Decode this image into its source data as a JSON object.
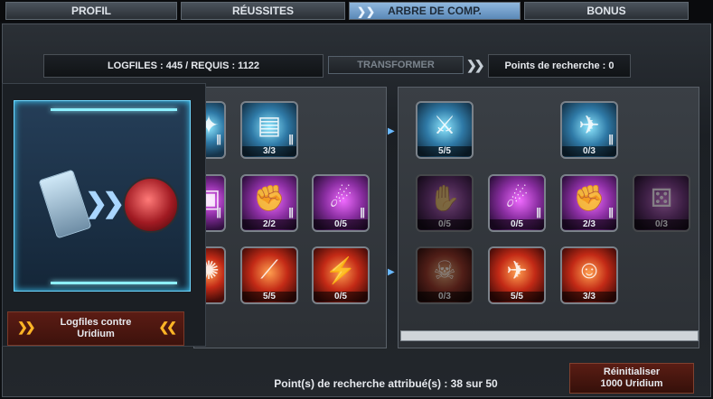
{
  "tabs": [
    {
      "label": "PROFIL"
    },
    {
      "label": "RÉUSSITES"
    },
    {
      "label": "ARBRE DE COMP.",
      "active": true
    },
    {
      "label": "BONUS"
    }
  ],
  "header": {
    "logfiles_requis": "LOGFILES : 445 / REQUIS : 1122",
    "transform_label": "TRANSFORMER",
    "research_points": "Points de recherche : 0"
  },
  "card": {
    "label_line1": "Logfiles contre",
    "label_line2": "Uridium"
  },
  "skills": [
    {
      "theme": "blue",
      "count": "",
      "dim": false
    },
    {
      "theme": "blue",
      "count": "3/3",
      "dim": false
    },
    {
      "theme": "purple",
      "count": "",
      "dim": false
    },
    {
      "theme": "purple",
      "count": "2/2",
      "dim": false
    },
    {
      "theme": "purple",
      "count": "0/5",
      "dim": false
    },
    {
      "theme": "red",
      "count": "",
      "dim": false
    },
    {
      "theme": "red",
      "count": "5/5",
      "dim": false
    },
    {
      "theme": "red",
      "count": "0/5",
      "dim": false
    },
    {
      "theme": "blue",
      "count": "5/5",
      "dim": false
    },
    {
      "theme": "blue",
      "count": "0/3",
      "dim": false
    },
    {
      "theme": "purple",
      "count": "0/5",
      "dim": true
    },
    {
      "theme": "purple",
      "count": "0/5",
      "dim": false
    },
    {
      "theme": "purple",
      "count": "2/3",
      "dim": false
    },
    {
      "theme": "purple",
      "count": "0/3",
      "dim": true
    },
    {
      "theme": "red",
      "count": "0/3",
      "dim": true
    },
    {
      "theme": "red",
      "count": "5/5",
      "dim": false
    },
    {
      "theme": "red",
      "count": "3/3",
      "dim": false
    }
  ],
  "footer": {
    "points_assigned": "Point(s) de recherche attribué(s) : 38 sur 50",
    "reset_line1": "Réinitialiser",
    "reset_line2": "1000 Uridium"
  }
}
